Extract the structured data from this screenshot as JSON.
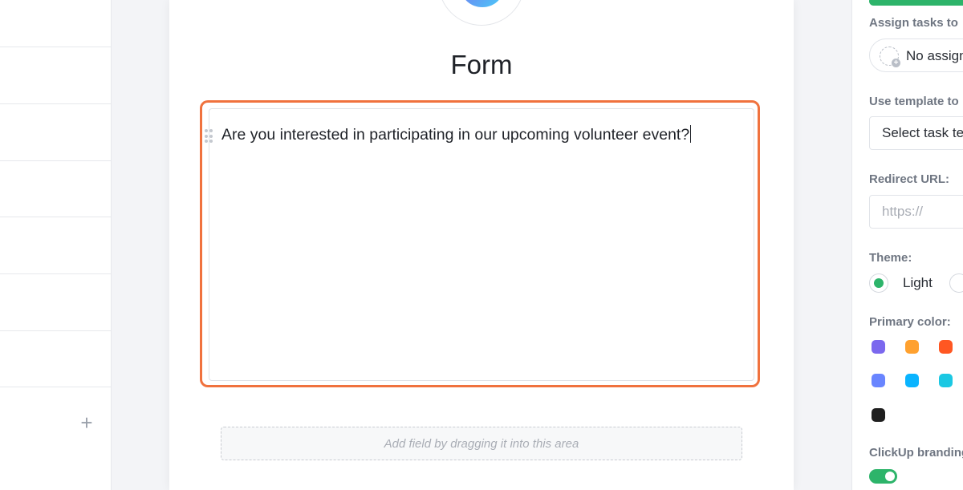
{
  "form": {
    "title": "Form",
    "question": "Are you interested in participating in our upcoming volunteer event?",
    "drop_zone_hint": "Add field by dragging it into this area"
  },
  "settings": {
    "assign_label": "Assign tasks to",
    "assign_value": "No assignee",
    "template_label": "Use template to",
    "template_value": "Select task template",
    "redirect_label": "Redirect URL:",
    "redirect_placeholder": "https://",
    "theme_label": "Theme:",
    "theme_light": "Light",
    "primary_color_label": "Primary color:",
    "colors": [
      "#7b68ee",
      "#ffa12f",
      "#ff5722",
      "#6985ff",
      "#0ab4ff",
      "#1bc8e3",
      "#1f1f1f"
    ],
    "branding_label": "ClickUp branding",
    "branding_on": true
  },
  "colors": {
    "highlight": "#f0723e",
    "accent_green": "#2db46a"
  }
}
